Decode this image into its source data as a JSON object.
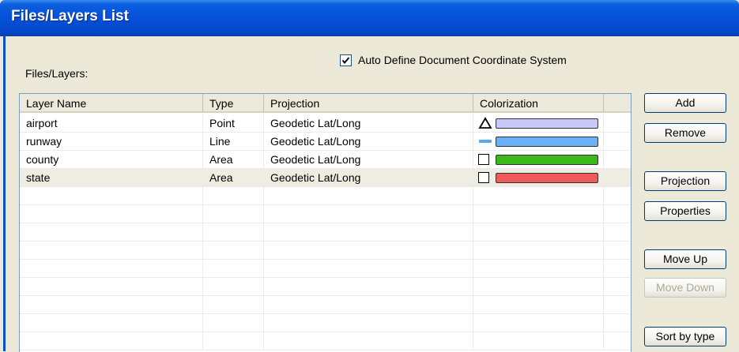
{
  "window": {
    "title": "Files/Layers List"
  },
  "files_label": "Files/Layers:",
  "auto_define": {
    "label": "Auto Define Document Coordinate System",
    "checked": true
  },
  "columns": [
    "Layer Name",
    "Type",
    "Projection",
    "Colorization",
    ""
  ],
  "layers": [
    {
      "name": "airport",
      "type": "Point",
      "projection": "Geodetic Lat/Long",
      "symbol": "triangle-icon",
      "color": "#c8c8f8"
    },
    {
      "name": "runway",
      "type": "Line",
      "projection": "Geodetic Lat/Long",
      "symbol": "line-icon",
      "color": "#6ab0f4"
    },
    {
      "name": "county",
      "type": "Area",
      "projection": "Geodetic Lat/Long",
      "symbol": "square-icon",
      "color": "#3cb81c"
    },
    {
      "name": "state",
      "type": "Area",
      "projection": "Geodetic Lat/Long",
      "symbol": "square-icon",
      "color": "#f05a5a",
      "selected": true
    }
  ],
  "buttons": {
    "add": "Add",
    "remove": "Remove",
    "projection": "Projection",
    "properties": "Properties",
    "move_up": "Move Up",
    "move_down": "Move Down",
    "sort_by_type": "Sort by type"
  }
}
